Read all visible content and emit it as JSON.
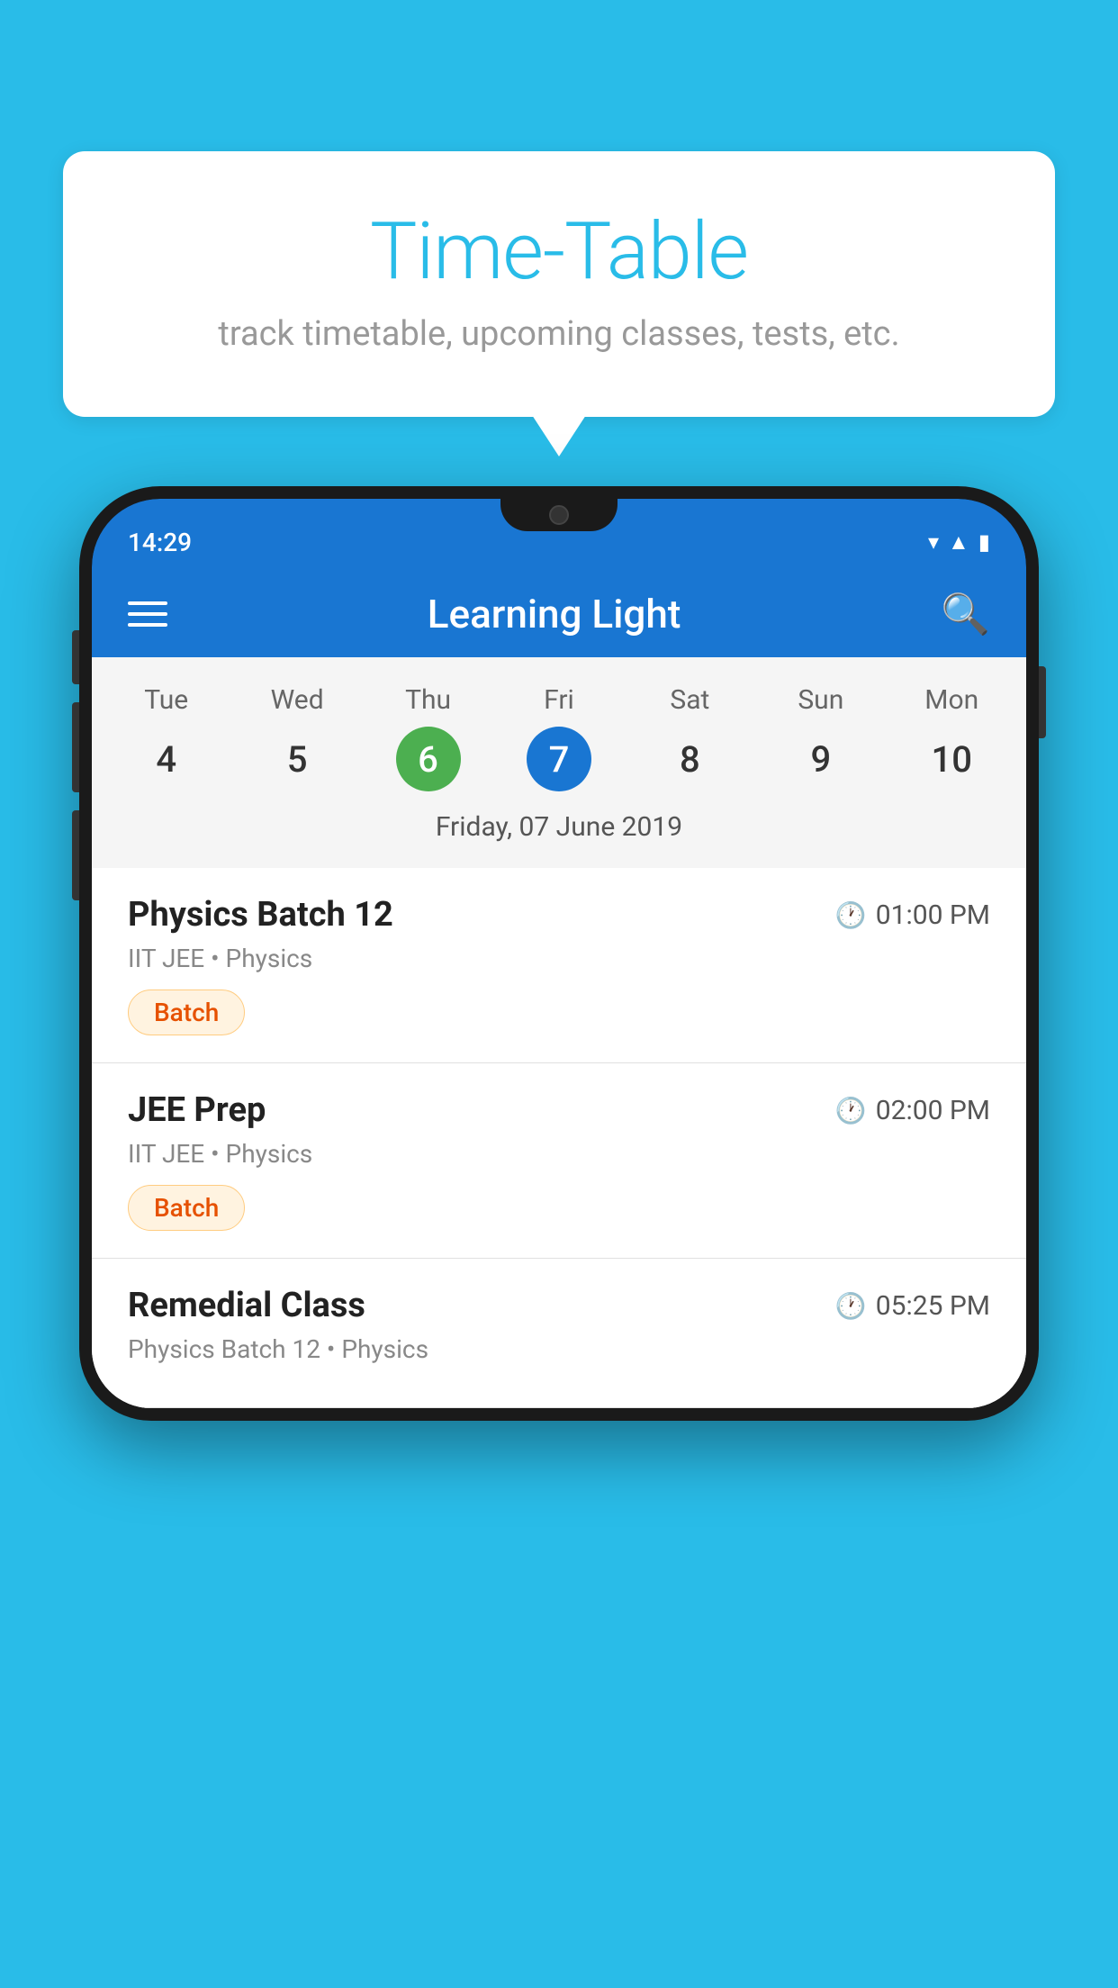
{
  "background": {
    "color": "#29bce8"
  },
  "tooltip": {
    "title": "Time-Table",
    "subtitle": "track timetable, upcoming classes, tests, etc."
  },
  "phone": {
    "status_bar": {
      "time": "14:29"
    },
    "app_bar": {
      "title": "Learning Light"
    },
    "calendar": {
      "days": [
        {
          "label": "Tue",
          "num": "4",
          "state": "normal"
        },
        {
          "label": "Wed",
          "num": "5",
          "state": "normal"
        },
        {
          "label": "Thu",
          "num": "6",
          "state": "today"
        },
        {
          "label": "Fri",
          "num": "7",
          "state": "selected"
        },
        {
          "label": "Sat",
          "num": "8",
          "state": "normal"
        },
        {
          "label": "Sun",
          "num": "9",
          "state": "normal"
        },
        {
          "label": "Mon",
          "num": "10",
          "state": "normal"
        }
      ],
      "selected_date_label": "Friday, 07 June 2019"
    },
    "schedule": [
      {
        "name": "Physics Batch 12",
        "time": "01:00 PM",
        "sub": "IIT JEE • Physics",
        "badge": "Batch"
      },
      {
        "name": "JEE Prep",
        "time": "02:00 PM",
        "sub": "IIT JEE • Physics",
        "badge": "Batch"
      },
      {
        "name": "Remedial Class",
        "time": "05:25 PM",
        "sub": "Physics Batch 12 • Physics",
        "badge": null
      }
    ]
  }
}
